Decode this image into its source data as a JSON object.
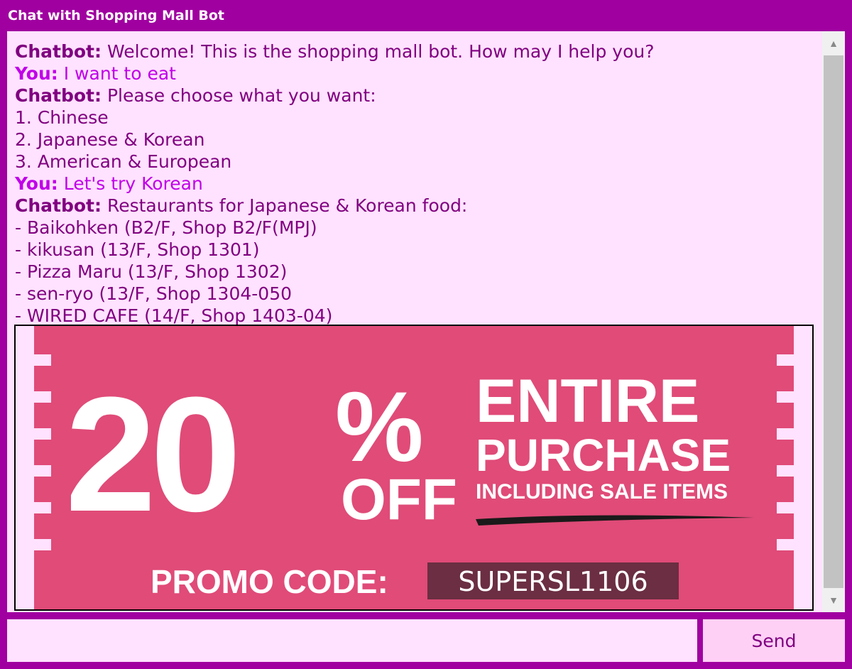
{
  "window": {
    "title": "Chat with Shopping Mall Bot"
  },
  "chat": {
    "messages": [
      {
        "speaker": "Chatbot:",
        "text": " Welcome! This is the shopping mall bot. How may I help you?"
      },
      {
        "speaker": "You:",
        "text": " I want to eat"
      },
      {
        "speaker": "Chatbot:",
        "text": " Please choose what you want:"
      },
      {
        "speaker": "",
        "text": "1. Chinese"
      },
      {
        "speaker": "",
        "text": "2. Japanese & Korean"
      },
      {
        "speaker": "",
        "text": "3. American & European"
      },
      {
        "speaker": "You:",
        "text": " Let's try Korean"
      },
      {
        "speaker": "Chatbot:",
        "text": " Restaurants for Japanese & Korean food:"
      },
      {
        "speaker": "",
        "text": "- Baikohken (B2/F, Shop B2/F(MPJ)"
      },
      {
        "speaker": "",
        "text": "- kikusan (13/F, Shop 1301)"
      },
      {
        "speaker": "",
        "text": "- Pizza Maru (13/F, Shop 1302)"
      },
      {
        "speaker": "",
        "text": "- sen-ryo (13/F, Shop 1304-050"
      },
      {
        "speaker": "",
        "text": "- WIRED CAFE (14/F, Shop 1403-04)"
      }
    ]
  },
  "coupon": {
    "percent": "20",
    "percent_sign": "%",
    "off": "OFF",
    "line1": "ENTIRE",
    "line2": "PURCHASE",
    "line3": "INCLUDING SALE ITEMS",
    "promo_label": "PROMO CODE:",
    "promo_code": "SUPERSL1106",
    "bg_color": "#e04b78",
    "code_bg_color": "#6b2e42"
  },
  "input": {
    "value": "",
    "placeholder": ""
  },
  "send": {
    "label": "Send"
  },
  "scrollbar": {
    "up_icon": "triangle-up",
    "down_icon": "triangle-down"
  }
}
